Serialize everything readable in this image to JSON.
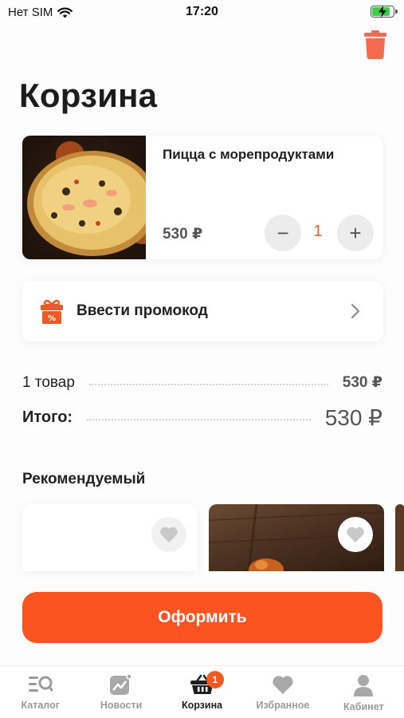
{
  "status_bar": {
    "carrier": "Нет SIM",
    "time": "17:20"
  },
  "page": {
    "title": "Корзина"
  },
  "cart_item": {
    "name": "Пицца с морепродуктами",
    "price": "530 ₽",
    "quantity": "1",
    "minus_label": "−",
    "plus_label": "+"
  },
  "promo": {
    "label": "Ввести промокод",
    "icon": "gift-percent-icon"
  },
  "summary": {
    "items_label": "1 товар",
    "items_amount": "530 ₽",
    "total_label": "Итого:",
    "total_amount": "530 ₽"
  },
  "recommended": {
    "title": "Рекомендуемый"
  },
  "checkout": {
    "label": "Оформить"
  },
  "tabs": [
    {
      "label": "Каталог",
      "icon": "catalog-search-icon"
    },
    {
      "label": "Новости",
      "icon": "news-chart-icon"
    },
    {
      "label": "Корзина",
      "icon": "basket-icon",
      "badge": "1"
    },
    {
      "label": "Избранное",
      "icon": "heart-icon"
    },
    {
      "label": "Кабинет",
      "icon": "user-icon"
    }
  ],
  "colors": {
    "accent": "#fb5420",
    "accent_text": "#f05a22",
    "muted": "#9a9a9a"
  }
}
